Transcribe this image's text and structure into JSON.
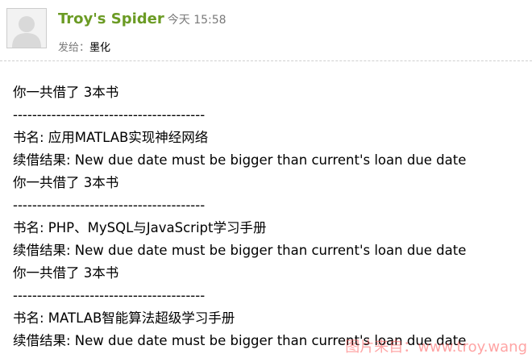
{
  "message": {
    "sender_name": "Troy's Spider",
    "time": "今天 15:58",
    "recipient_label": "发给：",
    "recipient_name": "墨化"
  },
  "body": {
    "blocks": [
      {
        "total": "你一共借了 3本书",
        "separator": "----------------------------------------",
        "title": "书名: 应用MATLAB实现神经网络",
        "result": "续借结果: New due date must be bigger than current's loan due date"
      },
      {
        "total": "你一共借了 3本书",
        "separator": "----------------------------------------",
        "title": "书名: PHP、MySQL与JavaScript学习手册",
        "result": "续借结果: New due date must be bigger than current's loan due date"
      },
      {
        "total": "你一共借了 3本书",
        "separator": "----------------------------------------",
        "title": "书名: MATLAB智能算法超级学习手册",
        "result": "续借结果: New due date must be bigger than current's loan due date"
      }
    ]
  },
  "watermark": "图片来自：www.troy.wang",
  "icons": {
    "avatar": "default-user-avatar-icon"
  },
  "colors": {
    "sender_name": "#6b9b24",
    "muted": "#7a7a7a",
    "watermark": "#ff5a5a"
  }
}
